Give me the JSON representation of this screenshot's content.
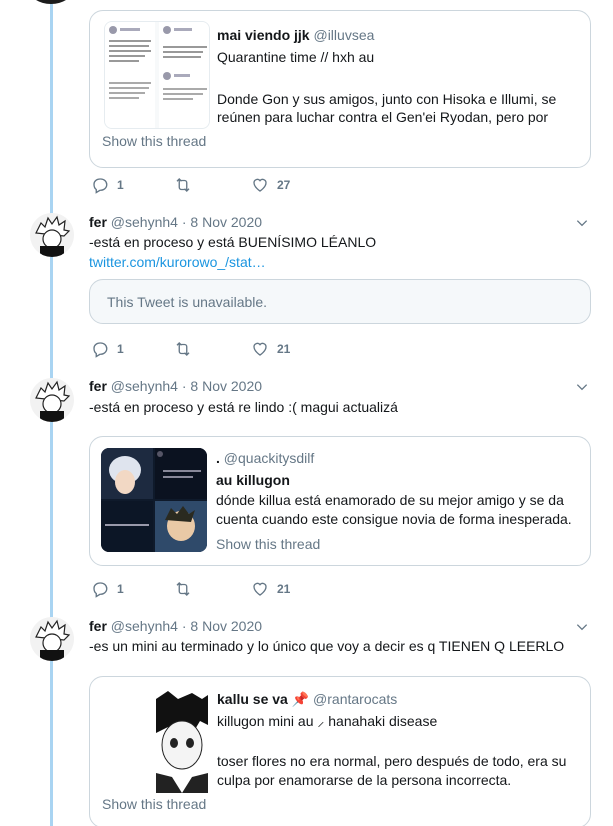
{
  "quoted_top": {
    "user_name": "mai viendo jjk",
    "handle": "@illuvsea",
    "line1": "Quarantine time // hxh au",
    "line2": "Donde Gon y sus amigos, junto con Hisoka e Illumi, se",
    "line3": "reúnen para luchar contra el Gen'ei Ryodan, pero por",
    "show_thread": "Show this thread"
  },
  "tweet0_actions": {
    "replies": "1",
    "likes": "27"
  },
  "tweets": [
    {
      "name": "fer",
      "handle": "@sehynh4",
      "sep": "·",
      "date": "8 Nov 2020",
      "text": "-está en proceso y está BUENÍSIMO LÉANLO",
      "link": "twitter.com/kurorowo_/stat…",
      "unavailable": "This Tweet is unavailable.",
      "replies": "1",
      "likes": "21"
    },
    {
      "name": "fer",
      "handle": "@sehynh4",
      "sep": "·",
      "date": "8 Nov 2020",
      "text": "-está en proceso y está re lindo :( magui actualizá",
      "quote": {
        "user_name": ".",
        "handle": "@quackitysdilf",
        "title": "au killugon",
        "line1": "dónde killua está enamorado de su mejor amigo y se da",
        "line2": "cuenta cuando este consigue novia de forma inesperada.",
        "show_thread": "Show this thread",
        "thumb_caption": "mi novia me regaló un amo mucho !",
        "thumb_caption2": "te siento así de repente"
      },
      "replies": "1",
      "likes": "21"
    },
    {
      "name": "fer",
      "handle": "@sehynh4",
      "sep": "·",
      "date": "8 Nov 2020",
      "text": "-es un mini au terminado y lo único que voy a decir es q TIENEN Q LEERLO",
      "quote": {
        "user_name": "kallu se va",
        "user_emoji": "📌",
        "handle": "@rantarocats",
        "line1": "killugon mini au ⸝ hanahaki disease",
        "line2": "toser flores no era normal, pero después de todo, era su",
        "line3": "culpa por enamorarse de la persona incorrecta.",
        "show_thread": "Show this thread"
      }
    }
  ],
  "colors": {
    "thread_line": "#a9d4f2",
    "link": "#1b95e0",
    "muted": "#657786",
    "border": "#ccd6dd"
  },
  "icons": [
    "reply-icon",
    "retweet-icon",
    "like-icon",
    "chevron-down-icon"
  ]
}
